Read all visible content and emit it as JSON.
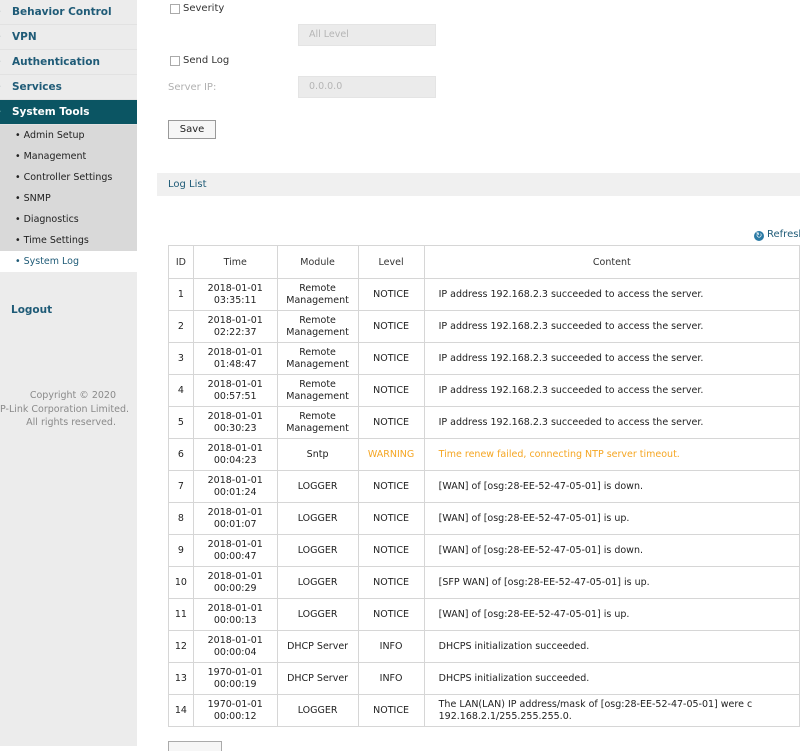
{
  "sidebar": {
    "items": [
      {
        "label": "Behavior Control",
        "active": false
      },
      {
        "label": "VPN",
        "active": false
      },
      {
        "label": "Authentication",
        "active": false
      },
      {
        "label": "Services",
        "active": false
      },
      {
        "label": "System Tools",
        "active": true
      }
    ],
    "sub_items": [
      {
        "label": "Admin Setup",
        "active": false
      },
      {
        "label": "Management",
        "active": false
      },
      {
        "label": "Controller Settings",
        "active": false
      },
      {
        "label": "SNMP",
        "active": false
      },
      {
        "label": "Diagnostics",
        "active": false
      },
      {
        "label": "Time Settings",
        "active": false
      },
      {
        "label": "System Log",
        "active": true
      }
    ],
    "logout": "Logout",
    "copyright": [
      "Copyright © 2020",
      "P-Link Corporation Limited.",
      "All rights reserved."
    ]
  },
  "form": {
    "severity_label": "Severity",
    "severity_value": "All Level",
    "send_log_label": "Send Log",
    "server_ip_label": "Server IP:",
    "server_ip_value": "0.0.0.0",
    "save_label": "Save"
  },
  "log_list": {
    "title": "Log List",
    "refresh_label": "Refresl",
    "columns": [
      "ID",
      "Time",
      "Module",
      "Level",
      "Content"
    ],
    "rows": [
      {
        "id": "1",
        "time": "2018-01-01 03:35:11",
        "module": [
          "Remote",
          "Management"
        ],
        "level": "NOTICE",
        "content": [
          "IP address 192.168.2.3 succeeded to access the server."
        ]
      },
      {
        "id": "2",
        "time": "2018-01-01 02:22:37",
        "module": [
          "Remote",
          "Management"
        ],
        "level": "NOTICE",
        "content": [
          "IP address 192.168.2.3 succeeded to access the server."
        ]
      },
      {
        "id": "3",
        "time": "2018-01-01 01:48:47",
        "module": [
          "Remote",
          "Management"
        ],
        "level": "NOTICE",
        "content": [
          "IP address 192.168.2.3 succeeded to access the server."
        ]
      },
      {
        "id": "4",
        "time": "2018-01-01 00:57:51",
        "module": [
          "Remote",
          "Management"
        ],
        "level": "NOTICE",
        "content": [
          "IP address 192.168.2.3 succeeded to access the server."
        ]
      },
      {
        "id": "5",
        "time": "2018-01-01 00:30:23",
        "module": [
          "Remote",
          "Management"
        ],
        "level": "NOTICE",
        "content": [
          "IP address 192.168.2.3 succeeded to access the server."
        ]
      },
      {
        "id": "6",
        "time": "2018-01-01 00:04:23",
        "module": [
          "Sntp"
        ],
        "level": "WARNING",
        "content": [
          "Time renew failed, connecting NTP server timeout."
        ]
      },
      {
        "id": "7",
        "time": "2018-01-01 00:01:24",
        "module": [
          "LOGGER"
        ],
        "level": "NOTICE",
        "content": [
          "[WAN] of [osg:28-EE-52-47-05-01] is down."
        ]
      },
      {
        "id": "8",
        "time": "2018-01-01 00:01:07",
        "module": [
          "LOGGER"
        ],
        "level": "NOTICE",
        "content": [
          "[WAN] of [osg:28-EE-52-47-05-01] is up."
        ]
      },
      {
        "id": "9",
        "time": "2018-01-01 00:00:47",
        "module": [
          "LOGGER"
        ],
        "level": "NOTICE",
        "content": [
          "[WAN] of [osg:28-EE-52-47-05-01] is down."
        ]
      },
      {
        "id": "10",
        "time": "2018-01-01 00:00:29",
        "module": [
          "LOGGER"
        ],
        "level": "NOTICE",
        "content": [
          "[SFP WAN] of [osg:28-EE-52-47-05-01] is up."
        ]
      },
      {
        "id": "11",
        "time": "2018-01-01 00:00:13",
        "module": [
          "LOGGER"
        ],
        "level": "NOTICE",
        "content": [
          "[WAN] of [osg:28-EE-52-47-05-01] is up."
        ]
      },
      {
        "id": "12",
        "time": "2018-01-01 00:00:04",
        "module": [
          "DHCP Server"
        ],
        "level": "INFO",
        "content": [
          "DHCPS initialization succeeded."
        ]
      },
      {
        "id": "13",
        "time": "1970-01-01 00:00:19",
        "module": [
          "DHCP Server"
        ],
        "level": "INFO",
        "content": [
          "DHCPS initialization succeeded."
        ]
      },
      {
        "id": "14",
        "time": "1970-01-01 00:00:12",
        "module": [
          "LOGGER"
        ],
        "level": "NOTICE",
        "content": [
          "The LAN(LAN) IP address/mask of [osg:28-EE-52-47-05-01] were c",
          "192.168.2.1/255.255.255.0."
        ]
      }
    ]
  },
  "colors": {
    "accent": "#0b5563",
    "link": "#1f5b77",
    "warning": "#f5a623"
  }
}
